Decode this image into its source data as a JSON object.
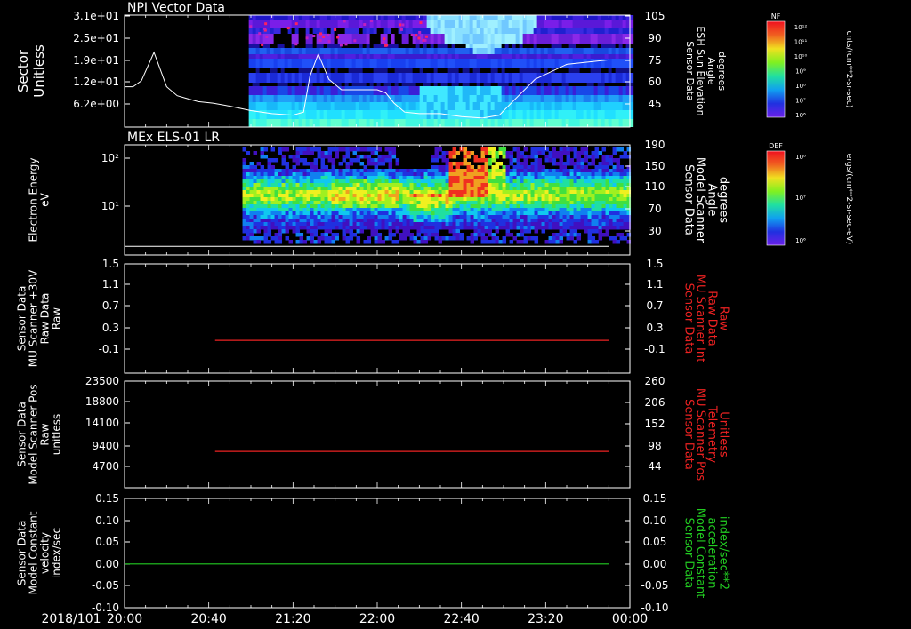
{
  "chart_data": [
    {
      "type": "heatmap",
      "title": "NPI Vector Data",
      "ylabel": [
        "Sector",
        "Unitless"
      ],
      "yticks": [
        "3.1e+01",
        "2.5e+01",
        "1.9e+01",
        "1.2e+01",
        "6.2e+00"
      ],
      "ylabel_right": [
        "Sensor Data",
        "ESH Sun Elevation",
        "Angle",
        "degrees"
      ],
      "yticks_right": [
        "105",
        "90",
        "75",
        "60",
        "45"
      ],
      "line_ylim": [
        30,
        105
      ],
      "line": {
        "x": [
          0,
          4,
          8,
          14,
          20,
          25,
          30,
          35,
          42,
          50,
          60,
          70,
          80,
          85,
          88,
          92,
          97,
          103,
          110,
          116,
          120,
          124,
          128,
          133,
          140,
          150,
          160,
          170,
          178,
          185,
          195,
          210,
          230
        ],
        "y": [
          57,
          57,
          61,
          80,
          57,
          51,
          49,
          47,
          46,
          44,
          41,
          39,
          38,
          40,
          64,
          79,
          62,
          55,
          55,
          55,
          55,
          53,
          46,
          40,
          39,
          39,
          37,
          36,
          38,
          48,
          62,
          72,
          75
        ]
      },
      "colorbar": {
        "label": "NF",
        "units": "cnts/(cm**2-sr-sec)",
        "ticks": [
          "10¹²",
          "10¹¹",
          "10¹⁰",
          "10⁹",
          "10⁸",
          "10⁷",
          "10⁶"
        ]
      }
    },
    {
      "type": "heatmap",
      "title": "MEx ELS-01 LR",
      "ylabel": [
        "Electron Energy",
        "eV"
      ],
      "yticks": [
        "10²",
        "10¹"
      ],
      "ylabel_right": [
        "Sensor Data",
        "Model Scanner",
        "Angle",
        "degrees"
      ],
      "yticks_right": [
        "190",
        "150",
        "110",
        "70",
        "30"
      ],
      "line_ylim": [
        0,
        190
      ],
      "line": {
        "x": [
          0,
          230
        ],
        "y": [
          15,
          15
        ]
      },
      "colorbar": {
        "label": "DEF",
        "units": "ergs/(cm**2-sr-sec-eV)",
        "ticks": [
          "10⁸",
          "10⁷",
          "10⁶"
        ]
      }
    },
    {
      "type": "line",
      "ylabel": [
        "Sensor Data",
        "MU Scanner +30V",
        "Raw Data",
        "Raw"
      ],
      "yticks": [
        "1.5",
        "1.1",
        "0.7",
        "0.3",
        "-0.1"
      ],
      "ylim": [
        -0.5,
        1.5
      ],
      "ylabel_right": [
        "Sensor Data",
        "MU Scanner Int",
        "Raw Data",
        "Raw"
      ],
      "yticks_right": [
        "1.5",
        "1.1",
        "0.7",
        "0.3",
        "-0.1"
      ],
      "series": [
        {
          "color": "#ee2222",
          "x": [
            43,
            230
          ],
          "y": [
            0.1,
            0.1
          ]
        }
      ]
    },
    {
      "type": "line",
      "ylabel": [
        "Sensor Data",
        "Model Scanner Pos",
        "Raw",
        "unitless"
      ],
      "yticks": [
        "23500",
        "18800",
        "14100",
        "9400",
        "4700"
      ],
      "ylim": [
        0,
        23500
      ],
      "ylabel_right": [
        "Sensor Data",
        "MU Scanner Pos",
        "Telemetry",
        "Unitless"
      ],
      "yticks_right": [
        "260",
        "206",
        "152",
        "98",
        "44"
      ],
      "series": [
        {
          "color": "#ee2222",
          "x": [
            43,
            230
          ],
          "y": [
            8000,
            8000
          ]
        }
      ]
    },
    {
      "type": "line",
      "ylabel": [
        "Sensor Data",
        "Model Constant",
        "velocity",
        "index/sec"
      ],
      "yticks": [
        "0.15",
        "0.10",
        "0.05",
        "0.00",
        "-0.05",
        "-0.10"
      ],
      "ylim": [
        -0.1,
        0.15
      ],
      "ylabel_right": [
        "Sensor Data",
        "Model Constant",
        "acceleration",
        "index/sec**2"
      ],
      "yticks_right": [
        "0.15",
        "0.10",
        "0.05",
        "0.00",
        "-0.05",
        "-0.10"
      ],
      "series": [
        {
          "color": "#22cc22",
          "x": [
            0,
            230
          ],
          "y": [
            0,
            0
          ]
        }
      ]
    }
  ],
  "x_axis": {
    "date": "2018/101",
    "ticks": [
      "20:00",
      "20:40",
      "21:20",
      "22:00",
      "22:40",
      "23:20",
      "00:00"
    ],
    "range_minutes": [
      0,
      240
    ]
  },
  "colors": {
    "background": "#000000",
    "axes": "#ffffff",
    "left_labels": "#ffffff",
    "right_label_red": "#ee2222",
    "right_label_green": "#22cc22"
  }
}
